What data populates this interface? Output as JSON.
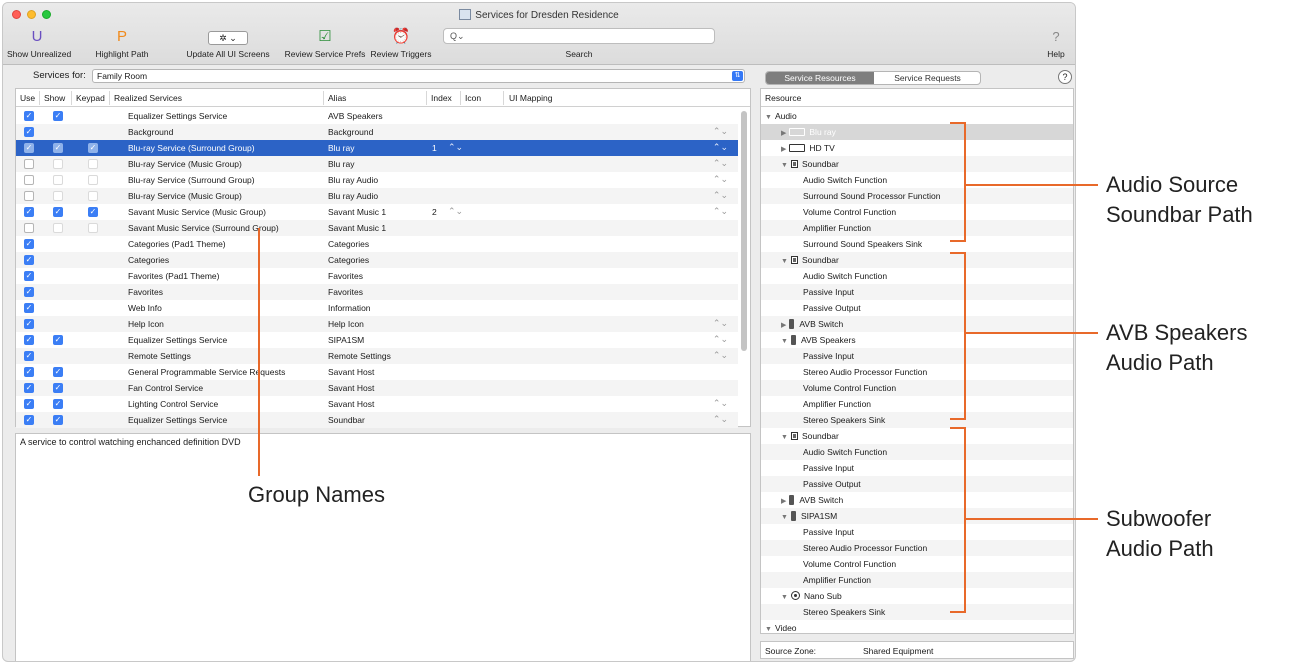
{
  "window": {
    "title": "Services for Dresden Residence",
    "colors": {
      "accent": "#2c63c6",
      "annotation": "#e8692a",
      "checkbox": "#3b7ef5"
    }
  },
  "toolbar": {
    "show_unrealized": {
      "icon": "U",
      "label": "Show Unrealized"
    },
    "highlight_path": {
      "icon": "P",
      "label": "Highlight Path"
    },
    "update_screens": {
      "icon": "gear-menu",
      "label": "Update All UI Screens"
    },
    "review_prefs": {
      "icon": "checklist",
      "label": "Review Service Prefs"
    },
    "review_triggers": {
      "icon": "alarm-clock",
      "label": "Review Triggers"
    },
    "search": {
      "placeholder": "Q⌄",
      "label": "Search"
    },
    "help": {
      "label": "Help"
    }
  },
  "services_for": {
    "label": "Services for:",
    "value": "Family Room"
  },
  "services_table": {
    "headers": [
      "Use",
      "Show",
      "Keypad",
      "Realized Services",
      "Alias",
      "Index",
      "Icon",
      "UI Mapping"
    ],
    "rows": [
      {
        "use": "on",
        "show": "on",
        "keypad": "none",
        "service": "Equalizer Settings Service",
        "alias": "AVB Speakers",
        "index": "",
        "step": false
      },
      {
        "use": "on",
        "show": "none",
        "keypad": "none",
        "service": "Background",
        "alias": "Background",
        "index": "",
        "step": true
      },
      {
        "use": "on",
        "show": "on",
        "keypad": "on",
        "service": "Blu-ray Service  (Surround Group)",
        "alias": "Blu ray",
        "index": "1",
        "step": true,
        "selected": true
      },
      {
        "use": "off",
        "show": "dim",
        "keypad": "dim",
        "service": "Blu-ray Service  (Music Group)",
        "alias": "Blu ray",
        "index": "",
        "step": true
      },
      {
        "use": "off",
        "show": "dim",
        "keypad": "dim",
        "service": "Blu-ray Service  (Surround Group)",
        "alias": "Blu ray Audio",
        "index": "",
        "step": true
      },
      {
        "use": "off",
        "show": "dim",
        "keypad": "dim",
        "service": "Blu-ray Service  (Music Group)",
        "alias": "Blu ray Audio",
        "index": "",
        "step": true
      },
      {
        "use": "on",
        "show": "on",
        "keypad": "on",
        "service": "Savant Music Service (Music Group)",
        "alias": "Savant Music 1",
        "index": "2",
        "step": true
      },
      {
        "use": "off",
        "show": "dim",
        "keypad": "dim",
        "service": "Savant Music Service (Surround Group)",
        "alias": "Savant Music 1",
        "index": "",
        "step": false
      },
      {
        "use": "on",
        "show": "none",
        "keypad": "none",
        "service": "Categories (Pad1 Theme)",
        "alias": "Categories",
        "index": "",
        "step": false
      },
      {
        "use": "on",
        "show": "none",
        "keypad": "none",
        "service": "Categories",
        "alias": "Categories",
        "index": "",
        "step": false
      },
      {
        "use": "on",
        "show": "none",
        "keypad": "none",
        "service": "Favorites (Pad1 Theme)",
        "alias": "Favorites",
        "index": "",
        "step": false
      },
      {
        "use": "on",
        "show": "none",
        "keypad": "none",
        "service": "Favorites",
        "alias": "Favorites",
        "index": "",
        "step": false
      },
      {
        "use": "on",
        "show": "none",
        "keypad": "none",
        "service": "Web Info",
        "alias": "Information",
        "index": "",
        "step": false
      },
      {
        "use": "on",
        "show": "none",
        "keypad": "none",
        "service": "Help Icon",
        "alias": "Help Icon",
        "index": "",
        "step": true
      },
      {
        "use": "on",
        "show": "on",
        "keypad": "none",
        "service": "Equalizer Settings  Service",
        "alias": "SIPA1SM",
        "index": "",
        "step": true
      },
      {
        "use": "on",
        "show": "none",
        "keypad": "none",
        "service": "Remote Settings",
        "alias": "Remote Settings",
        "index": "",
        "step": true
      },
      {
        "use": "on",
        "show": "on",
        "keypad": "none",
        "service": "General Programmable Service Requests",
        "alias": "Savant Host",
        "index": "",
        "step": false
      },
      {
        "use": "on",
        "show": "on",
        "keypad": "none",
        "service": "Fan Control Service",
        "alias": "Savant Host",
        "index": "",
        "step": false
      },
      {
        "use": "on",
        "show": "on",
        "keypad": "none",
        "service": "Lighting Control Service",
        "alias": "Savant Host",
        "index": "",
        "step": true
      },
      {
        "use": "on",
        "show": "on",
        "keypad": "none",
        "service": "Equalizer Settings  Service",
        "alias": "Soundbar",
        "index": "",
        "step": true
      }
    ]
  },
  "description": "A service to control watching enchanced definition DVD",
  "right_panel": {
    "tabs": [
      "Service Resources",
      "Service Requests"
    ],
    "help": "?",
    "resource_header": "Resource",
    "tree": [
      {
        "level": 0,
        "toggle": "▼",
        "icon": "",
        "label": "Audio"
      },
      {
        "level": 1,
        "toggle": "▶",
        "icon": "device",
        "label": "Blu ray",
        "highlight": true
      },
      {
        "level": 1,
        "toggle": "▶",
        "icon": "device",
        "label": "HD TV"
      },
      {
        "level": 1,
        "toggle": "▼",
        "icon": "soundbar",
        "label": "Soundbar"
      },
      {
        "level": 2,
        "toggle": "",
        "icon": "",
        "label": "Audio Switch Function"
      },
      {
        "level": 2,
        "toggle": "",
        "icon": "",
        "label": "Surround Sound Processor Function"
      },
      {
        "level": 2,
        "toggle": "",
        "icon": "",
        "label": "Volume Control Function"
      },
      {
        "level": 2,
        "toggle": "",
        "icon": "",
        "label": "Amplifier Function"
      },
      {
        "level": 2,
        "toggle": "",
        "icon": "",
        "label": "Surround Sound Speakers Sink"
      },
      {
        "level": 1,
        "toggle": "▼",
        "icon": "soundbar",
        "label": "Soundbar"
      },
      {
        "level": 2,
        "toggle": "",
        "icon": "",
        "label": "Audio Switch Function"
      },
      {
        "level": 2,
        "toggle": "",
        "icon": "",
        "label": "Passive Input"
      },
      {
        "level": 2,
        "toggle": "",
        "icon": "",
        "label": "Passive Output"
      },
      {
        "level": 1,
        "toggle": "▶",
        "icon": "speaker",
        "label": "AVB Switch"
      },
      {
        "level": 1,
        "toggle": "▼",
        "icon": "speaker",
        "label": "AVB Speakers"
      },
      {
        "level": 2,
        "toggle": "",
        "icon": "",
        "label": "Passive Input"
      },
      {
        "level": 2,
        "toggle": "",
        "icon": "",
        "label": "Stereo Audio Processor Function"
      },
      {
        "level": 2,
        "toggle": "",
        "icon": "",
        "label": "Volume Control Function"
      },
      {
        "level": 2,
        "toggle": "",
        "icon": "",
        "label": "Amplifier Function"
      },
      {
        "level": 2,
        "toggle": "",
        "icon": "",
        "label": "Stereo Speakers Sink"
      },
      {
        "level": 1,
        "toggle": "▼",
        "icon": "soundbar",
        "label": "Soundbar"
      },
      {
        "level": 2,
        "toggle": "",
        "icon": "",
        "label": "Audio Switch Function"
      },
      {
        "level": 2,
        "toggle": "",
        "icon": "",
        "label": "Passive Input"
      },
      {
        "level": 2,
        "toggle": "",
        "icon": "",
        "label": "Passive Output"
      },
      {
        "level": 1,
        "toggle": "▶",
        "icon": "speaker",
        "label": "AVB Switch"
      },
      {
        "level": 1,
        "toggle": "▼",
        "icon": "speaker",
        "label": "SIPA1SM"
      },
      {
        "level": 2,
        "toggle": "",
        "icon": "",
        "label": "Passive Input"
      },
      {
        "level": 2,
        "toggle": "",
        "icon": "",
        "label": "Stereo Audio Processor Function"
      },
      {
        "level": 2,
        "toggle": "",
        "icon": "",
        "label": "Volume Control Function"
      },
      {
        "level": 2,
        "toggle": "",
        "icon": "",
        "label": "Amplifier Function"
      },
      {
        "level": 1,
        "toggle": "▼",
        "icon": "sub",
        "label": "Nano Sub"
      },
      {
        "level": 2,
        "toggle": "",
        "icon": "",
        "label": "Stereo Speakers Sink"
      },
      {
        "level": 0,
        "toggle": "▼",
        "icon": "",
        "label": "Video"
      }
    ],
    "source_zone_label": "Source Zone:",
    "source_zone_value": "Shared Equipment"
  },
  "annotations": {
    "group_names": "Group Names",
    "audio_source_1": "Audio Source",
    "audio_source_2": "Soundbar Path",
    "avb_1": "AVB Speakers",
    "avb_2": "Audio Path",
    "sub_1": "Subwoofer",
    "sub_2": "Audio Path"
  }
}
